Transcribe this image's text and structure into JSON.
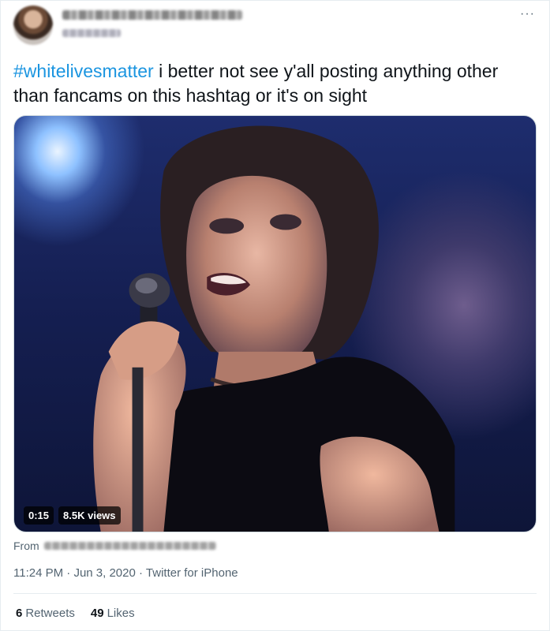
{
  "header": {
    "more_icon": "more-horizontal-icon",
    "more_label": "···"
  },
  "tweet": {
    "hashtag": "#whitelivesmatter",
    "text": " i better not see y'all posting anything other than fancams on this hashtag or it's on sight"
  },
  "media": {
    "duration": "0:15",
    "views": "8.5K views"
  },
  "from": {
    "label": "From"
  },
  "meta": {
    "time": "11:24 PM",
    "separator1": " · ",
    "date": "Jun 3, 2020",
    "separator2": " · ",
    "source": "Twitter for iPhone"
  },
  "stats": {
    "retweets_count": "6",
    "retweets_label": "Retweets",
    "likes_count": "49",
    "likes_label": "Likes"
  },
  "colors": {
    "link": "#1b95e0",
    "muted": "#536471",
    "text": "#0f1419"
  }
}
